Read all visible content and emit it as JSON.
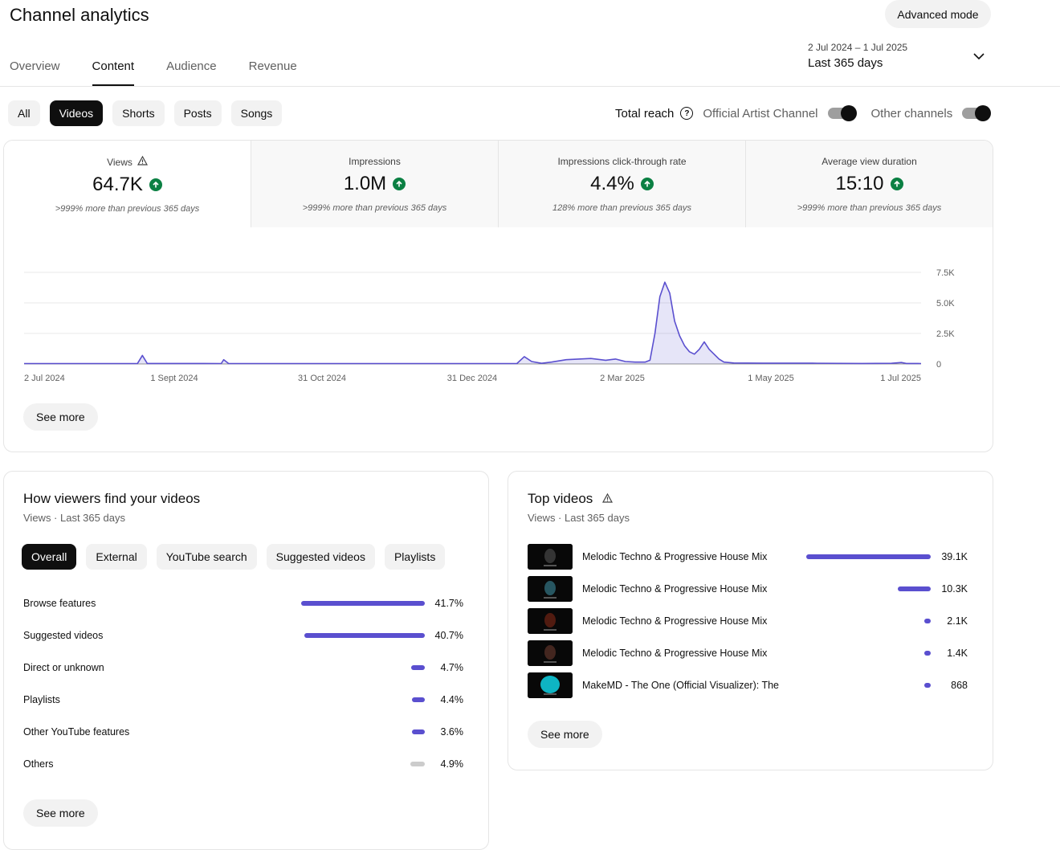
{
  "header": {
    "title": "Channel analytics",
    "advanced_mode": "Advanced mode",
    "tabs": [
      "Overview",
      "Content",
      "Audience",
      "Revenue"
    ],
    "active_tab": "Content",
    "date_range": "2 Jul 2024 – 1 Jul 2025",
    "date_preset": "Last 365 days"
  },
  "filters": {
    "chips": [
      "All",
      "Videos",
      "Shorts",
      "Posts",
      "Songs"
    ],
    "selected": "Videos",
    "total_reach": "Total reach",
    "help_glyph": "?",
    "official_artist_channel": "Official Artist Channel",
    "official_artist_channel_on": true,
    "other_channels": "Other channels",
    "other_channels_on": true
  },
  "metrics": [
    {
      "label": "Views",
      "value": "64.7K",
      "delta": ">999% more than previous 365 days",
      "warning": true
    },
    {
      "label": "Impressions",
      "value": "1.0M",
      "delta": ">999% more than previous 365 days",
      "warning": false
    },
    {
      "label": "Impressions click-through rate",
      "value": "4.4%",
      "delta": "128% more than previous 365 days",
      "warning": false
    },
    {
      "label": "Average view duration",
      "value": "15:10",
      "delta": ">999% more than previous 365 days",
      "warning": false
    }
  ],
  "chart_data": {
    "type": "area",
    "title": "",
    "xlabel": "",
    "ylabel": "",
    "x_tick_labels": [
      "2 Jul 2024",
      "1 Sept 2024",
      "31 Oct 2024",
      "31 Dec 2024",
      "2 Mar 2025",
      "1 May 2025",
      "1 Jul 2025"
    ],
    "y_tick_labels": [
      "7.5K",
      "5.0K",
      "2.5K",
      "0"
    ],
    "ylim": [
      0,
      7500
    ],
    "x_range_days": [
      0,
      364
    ],
    "grid": true,
    "accent": "#5a4fcf",
    "series": [
      {
        "points": [
          [
            0,
            30
          ],
          [
            40,
            30
          ],
          [
            46,
            40
          ],
          [
            48,
            700
          ],
          [
            50,
            40
          ],
          [
            80,
            30
          ],
          [
            81,
            350
          ],
          [
            83,
            30
          ],
          [
            200,
            30
          ],
          [
            203,
            600
          ],
          [
            206,
            200
          ],
          [
            210,
            50
          ],
          [
            214,
            150
          ],
          [
            220,
            350
          ],
          [
            225,
            400
          ],
          [
            230,
            450
          ],
          [
            236,
            300
          ],
          [
            240,
            400
          ],
          [
            244,
            200
          ],
          [
            248,
            150
          ],
          [
            252,
            150
          ],
          [
            254,
            300
          ],
          [
            256,
            2500
          ],
          [
            258,
            5500
          ],
          [
            260,
            6700
          ],
          [
            262,
            5800
          ],
          [
            264,
            3500
          ],
          [
            266,
            2300
          ],
          [
            268,
            1500
          ],
          [
            270,
            1000
          ],
          [
            272,
            800
          ],
          [
            274,
            1200
          ],
          [
            276,
            1800
          ],
          [
            278,
            1200
          ],
          [
            280,
            800
          ],
          [
            282,
            400
          ],
          [
            284,
            150
          ],
          [
            288,
            80
          ],
          [
            300,
            60
          ],
          [
            320,
            60
          ],
          [
            340,
            40
          ],
          [
            352,
            50
          ],
          [
            356,
            120
          ],
          [
            358,
            40
          ],
          [
            364,
            30
          ]
        ]
      }
    ]
  },
  "main_see_more": "See more",
  "traffic": {
    "title": "How viewers find your videos",
    "subtitle": "Views · Last 365 days",
    "chips": [
      "Overall",
      "External",
      "YouTube search",
      "Suggested videos",
      "Playlists"
    ],
    "selected": "Overall",
    "rows": [
      {
        "name": "Browse features",
        "value": "41.7%",
        "pct": 41.7,
        "grey": false
      },
      {
        "name": "Suggested videos",
        "value": "40.7%",
        "pct": 40.7,
        "grey": false
      },
      {
        "name": "Direct or unknown",
        "value": "4.7%",
        "pct": 4.7,
        "grey": false
      },
      {
        "name": "Playlists",
        "value": "4.4%",
        "pct": 4.4,
        "grey": false
      },
      {
        "name": "Other YouTube features",
        "value": "3.6%",
        "pct": 3.6,
        "grey": false
      },
      {
        "name": "Others",
        "value": "4.9%",
        "pct": 4.9,
        "grey": true
      }
    ],
    "see_more": "See more"
  },
  "top_videos": {
    "title": "Top videos",
    "subtitle": "Views · Last 365 days",
    "rows": [
      {
        "title": "Melodic Techno & Progressive House Mix",
        "value": "39.1K",
        "views": 39100
      },
      {
        "title": "Melodic Techno & Progressive House Mix",
        "value": "10.3K",
        "views": 10300
      },
      {
        "title": "Melodic Techno & Progressive House Mix",
        "value": "2.1K",
        "views": 2100
      },
      {
        "title": "Melodic Techno & Progressive House Mix",
        "value": "1.4K",
        "views": 1400
      },
      {
        "title": "MakeMD - The One (Official Visualizer): The",
        "value": "868",
        "views": 868
      }
    ],
    "see_more": "See more"
  }
}
